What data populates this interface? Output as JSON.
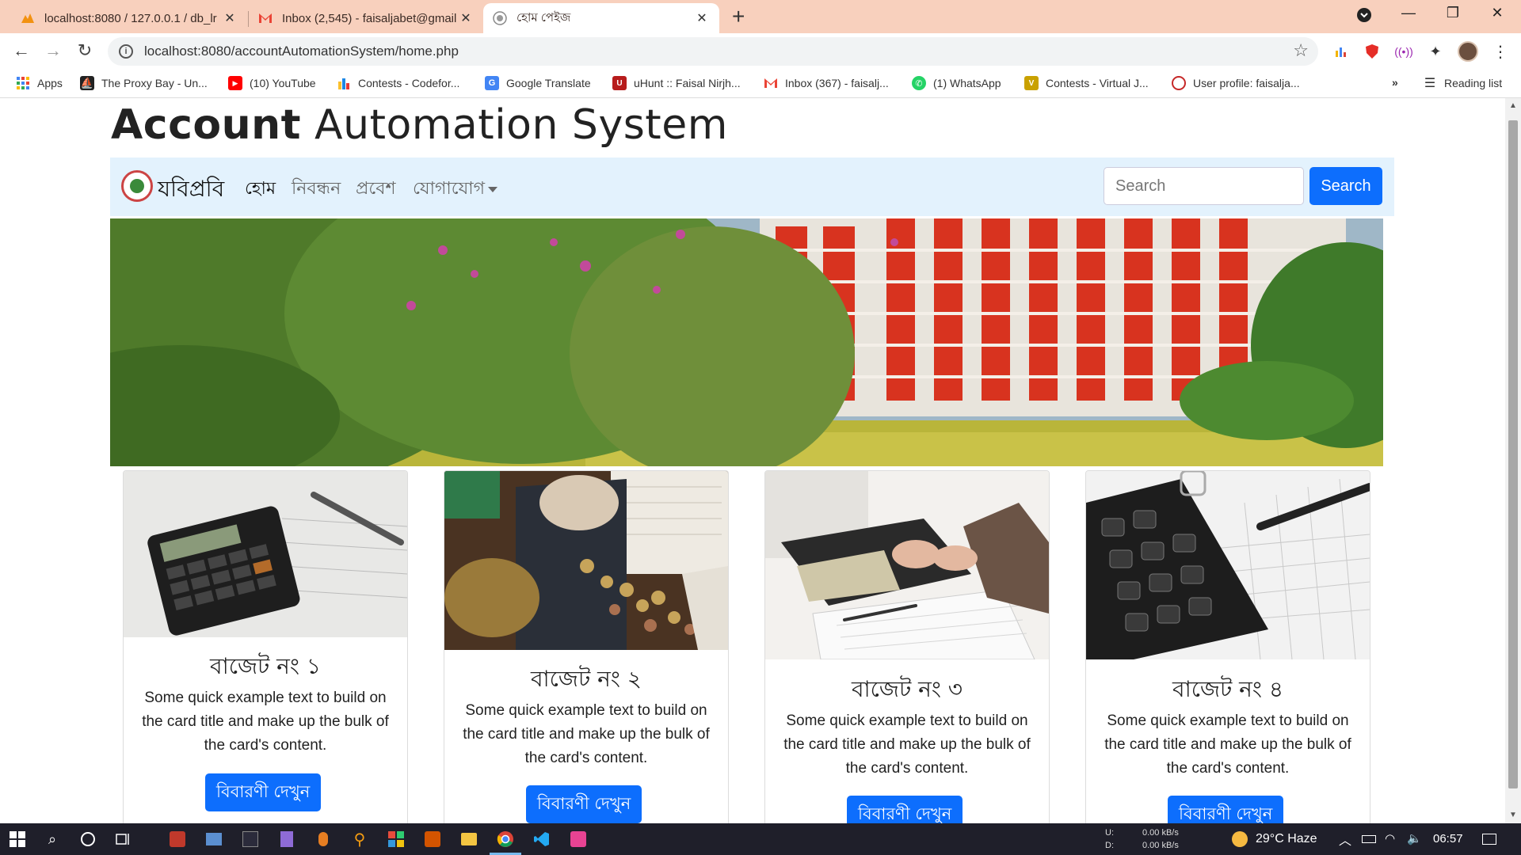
{
  "browser": {
    "tabs": [
      {
        "label": "localhost:8080 / 127.0.0.1 / db_lr",
        "icon": "phpmyadmin-icon"
      },
      {
        "label": "Inbox (2,545) - faisaljabet@gmail",
        "icon": "gmail-icon"
      },
      {
        "label": "হোম পেইজ",
        "icon": "site-logo-icon"
      }
    ],
    "url": "localhost:8080/accountAutomationSystem/home.php",
    "bookmarks": [
      {
        "label": "Apps",
        "icon": "apps-grid-icon",
        "color": "#4285f4"
      },
      {
        "label": "The Proxy Bay - Un...",
        "icon": "pirate-ship-icon",
        "color": "#222222"
      },
      {
        "label": "(10) YouTube",
        "icon": "youtube-icon",
        "color": "#ff0000"
      },
      {
        "label": "Contests - Codefor...",
        "icon": "codeforces-icon",
        "color": "#1e88e5"
      },
      {
        "label": "Google Translate",
        "icon": "google-translate-icon",
        "color": "#4285f4"
      },
      {
        "label": "uHunt :: Faisal Nirjh...",
        "icon": "uhunt-icon",
        "color": "#b71c1c"
      },
      {
        "label": "Inbox (367) - faisalj...",
        "icon": "gmail-icon",
        "color": "#ea4335"
      },
      {
        "label": "(1) WhatsApp",
        "icon": "whatsapp-icon",
        "color": "#25d366"
      },
      {
        "label": "Contests - Virtual J...",
        "icon": "vjudge-icon",
        "color": "#c9a100"
      },
      {
        "label": "User profile: faisalja...",
        "icon": "profile-icon",
        "color": "#c62828"
      }
    ],
    "overflow": "»",
    "reading_list": "Reading list"
  },
  "site": {
    "title_bold": "Account",
    "title_rest": "Automation System",
    "brand": "যবিপ্রবি",
    "nav": [
      {
        "label": "হোম",
        "active": true
      },
      {
        "label": "নিবন্ধন",
        "active": false
      },
      {
        "label": "প্রবেশ",
        "active": false
      },
      {
        "label": "যোগাযোগ",
        "active": false,
        "dropdown": true
      }
    ],
    "search_placeholder": "Search",
    "search_button": "Search",
    "accent_color": "#0d6efd",
    "navbar_color": "#e3f2fd"
  },
  "cards": [
    {
      "title": "বাজেট নং ১",
      "text": "Some quick example text to build on the card title and make up the bulk of the card's content.",
      "button": "বিবারণী দেখুন",
      "image": "calculator-on-papers"
    },
    {
      "title": "বাজেট নং ২",
      "text": "Some quick example text to build on the card title and make up the bulk of the card's content.",
      "button": "বিবারণী দেখুন",
      "image": "coins-and-piggy-bank"
    },
    {
      "title": "বাজেট নং ৩",
      "text": "Some quick example text to build on the card title and make up the bulk of the card's content.",
      "button": "বিবারণী দেখুন",
      "image": "hands-counting-cash"
    },
    {
      "title": "বাজেট নং ৪",
      "text": "Some quick example text to build on the card title and make up the bulk of the card's content.",
      "button": "বিবারণী দেখুন",
      "image": "calculator-close-up"
    }
  ],
  "taskbar": {
    "net_up_label": "U:",
    "net_down_label": "D:",
    "net_up": "0.00 kB/s",
    "net_down": "0.00 kB/s",
    "weather": "29°C  Haze",
    "time": "06:57"
  }
}
